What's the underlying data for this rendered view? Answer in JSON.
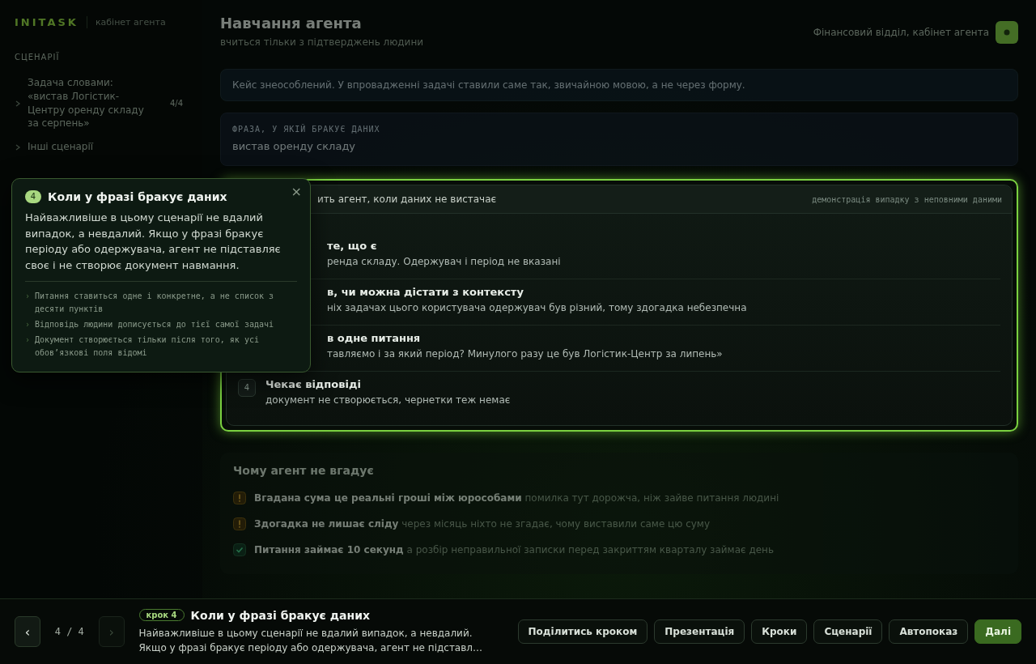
{
  "sidebar": {
    "brand": "INITASK",
    "subtitle": "кабінет агента",
    "section_label": "СЦЕНАРІЇ",
    "items": [
      {
        "label": "Задача словами: «вистав Логістик-Центру оренду складу за серпень»",
        "count": "4/4"
      },
      {
        "label": "Інші сценарії"
      }
    ]
  },
  "header": {
    "title": "Навчання агента",
    "subtitle": "вчиться тільки з підтверджень людини",
    "account": "Фінансовий відділ, кабінет агента"
  },
  "notice": "Кейс знеособлений. У впровадженні задачі ставили саме так, звичайною мовою, а не через форму.",
  "phrase_card": {
    "label": "ФРАЗА, У ЯКІЙ БРАКУЄ ДАНИХ",
    "text": "вистав оренду складу"
  },
  "demo_card": {
    "title": "ить агент, коли даних не вистачає",
    "caption": "демонстрація випадку з неповними даними",
    "steps": [
      {
        "title": "те, що є",
        "description": "ренда складу. Одержувач і період не вказані"
      },
      {
        "title": "в, чи можна дістати з контексту",
        "description": "ніх задачах цього користувача одержувач був різний, тому здогадка небезпечна"
      },
      {
        "title": "в одне питання",
        "description": "тавляємо і за який період? Минулого разу це був Логістик-Центр за липень»"
      },
      {
        "number": "4",
        "title": "Чекає відповіді",
        "description": "документ не створюється, чернетки теж немає"
      }
    ]
  },
  "reasons": {
    "title": "Чому агент не вгадує",
    "items": [
      {
        "kind": "warning",
        "text": "**Вгадана сума це реальні гроші між юрособами** помилка тут дорожча, ніж зайве питання людині"
      },
      {
        "kind": "warning",
        "text": "**Здогадка не лишає сліду** через місяць ніхто не згадає, чому виставили саме цю суму"
      },
      {
        "kind": "ok",
        "text": "**Питання займає 10 секунд** а розбір неправильної записки перед закриттям кварталу займає день"
      }
    ]
  },
  "popover": {
    "badge": "4",
    "title": "Коли у фразі бракує даних",
    "close": "×",
    "body": "Найважливіше в цьому сценарії не вдалий випадок, а невдалий. Якщо у фразі бракує періоду або одержувача, агент не підставляє своє і не створює документ навмання.",
    "points": [
      {
        "marker": "›",
        "text": "Питання ставиться одне і конкретне, а не список з десяти пунктів"
      },
      {
        "marker": "›",
        "text": "Відповідь людини дописується до тієї самої задачі"
      },
      {
        "marker": "›",
        "text": "Документ створюється тільки після того, як усі обов’язкові поля відомі"
      }
    ]
  },
  "tour_bar": {
    "prev": "‹",
    "counter": "4 / 4",
    "next": {
      "label": "›",
      "disabled": true
    },
    "step_badge": "крок 4",
    "title": "Коли у фразі бракує даних",
    "description": "Найважливіше в цьому сценарії не вдалий випадок, а невдалий. Якщо у фразі бракує періоду або одержувача, агент не підставл…",
    "buttons": [
      {
        "label": "Поділитись кроком",
        "kind": "secondary"
      },
      {
        "label": "Презентація",
        "kind": "secondary"
      },
      {
        "label": "Кроки",
        "kind": "secondary"
      },
      {
        "label": "Сценарії",
        "kind": "secondary"
      },
      {
        "label": "Автопоказ",
        "kind": "secondary"
      },
      {
        "label": "Далі",
        "kind": "primary"
      }
    ]
  }
}
